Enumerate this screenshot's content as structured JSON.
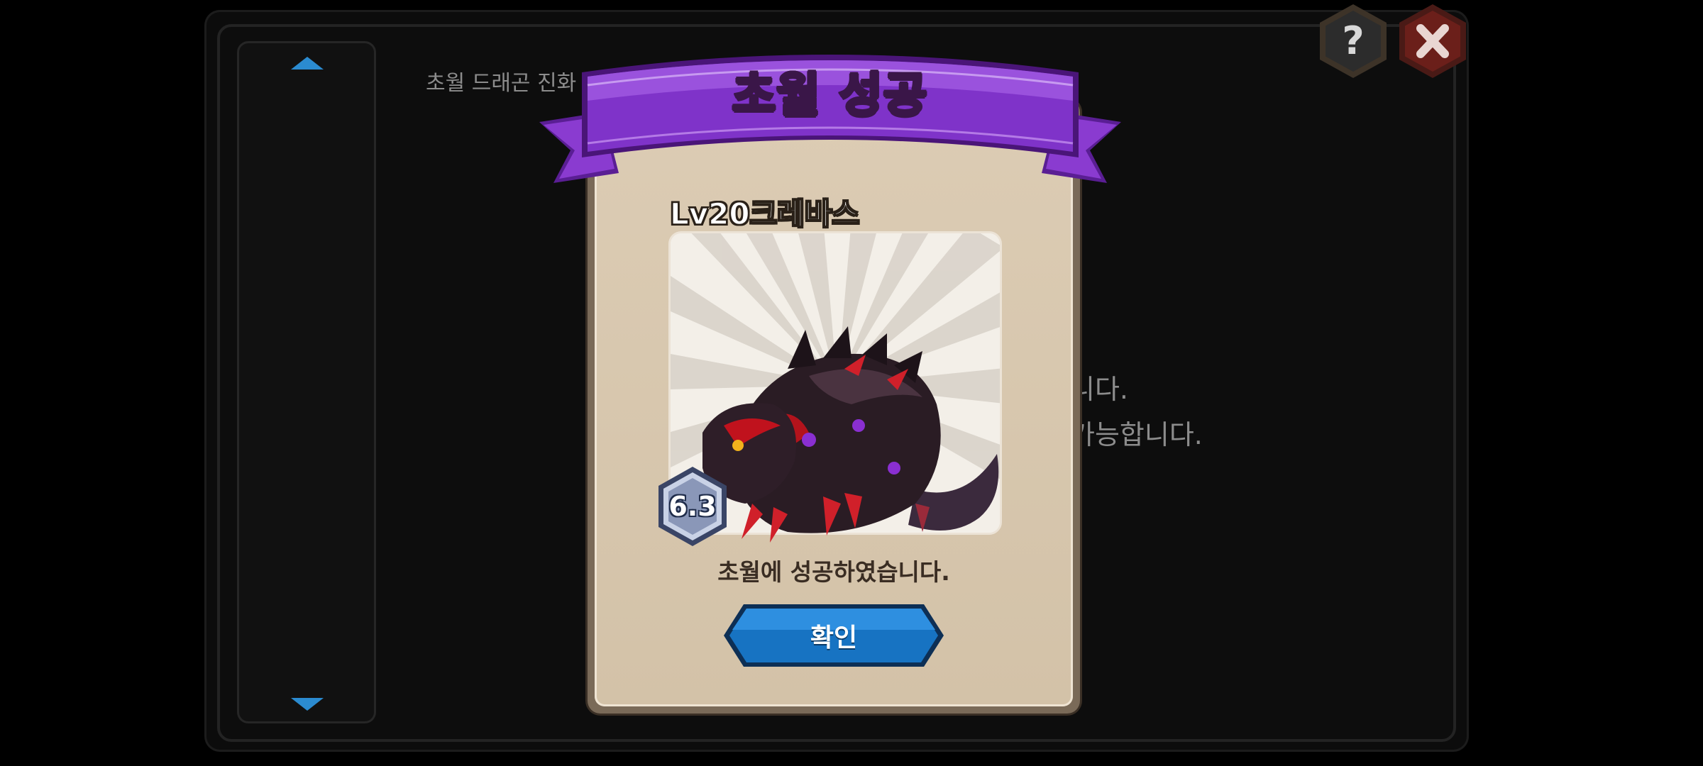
{
  "background": {
    "description_line": "초월 드래곤 진화",
    "line_2": "니다.",
    "line_3": "가능합니다."
  },
  "top_buttons": {
    "help_icon": "question-icon",
    "close_icon": "close-icon"
  },
  "modal": {
    "title": "초월 성공",
    "dragon_name": "Lv20크레바스",
    "grade_badge": "6.3",
    "message": "초월에 성공하였습니다.",
    "confirm_label": "확인"
  },
  "colors": {
    "ribbon": "#7a2fc4",
    "title_text": "#ffd21f",
    "confirm_button": "#1773c2",
    "card": "#d8c8ae",
    "scroll_arrow": "#2b8bd0"
  }
}
